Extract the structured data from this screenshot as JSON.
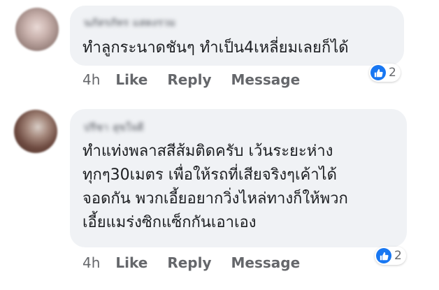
{
  "comments": [
    {
      "author": "นภัสรภัทร แสดงรวม",
      "text_lines": [
        "ทำลูกระนาดชันๆ ทำเป็น4เหลี่ยมเลยก็ได้"
      ],
      "time": "4h",
      "like_label": "Like",
      "reply_label": "Reply",
      "message_label": "Message",
      "reaction_count": "2"
    },
    {
      "author": "ปรีชา สุขใจดี",
      "text_lines": [
        "ทำแท่งพลาสสีส้มติดครับ เว้นระยะห่าง",
        "ทุกๆ30เมตร เพื่อให้รถที่เสียจริงๆเค้าได้",
        "จอดกัน พวกเอี้ยอยากวิ่งไหล่ทางก็ให้พวก",
        "เอี้ยแมร่งซิกแซ็กกันเอาเอง"
      ],
      "time": "4h",
      "like_label": "Like",
      "reply_label": "Reply",
      "message_label": "Message",
      "reaction_count": "2"
    }
  ],
  "colors": {
    "bubble": "#f0f2f5",
    "text": "#1c1e21",
    "meta": "#65676b",
    "like_blue": "#1877f2"
  },
  "icons": {
    "reaction": "thumbs-up-icon"
  }
}
